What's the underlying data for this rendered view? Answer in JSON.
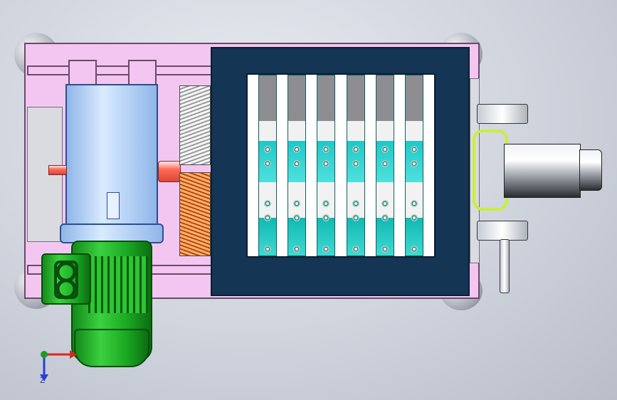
{
  "viewport": {
    "background_color": "#cfd4dd",
    "model": "shredder-assembly-top-view"
  },
  "colors": {
    "frame": "#f3c6f1",
    "gearbox": "#a7c9f2",
    "motor": "#2cc533",
    "hopper": "#143553",
    "cutters_teal": "#2fd6d2",
    "coupling": "#ff6a52",
    "gear_orange": "#e06a1c",
    "hydraulic_line": "#c9f03a",
    "axis_x": "#d9281f",
    "axis_y": "#1f9a2c",
    "axis_z": "#2a3fd1"
  },
  "triad": {
    "z_label": "Z"
  },
  "cutters": {
    "count": 6
  },
  "icons": {
    "triad": "axis-triad-icon",
    "motor_badge": "motor-logo-icon"
  }
}
